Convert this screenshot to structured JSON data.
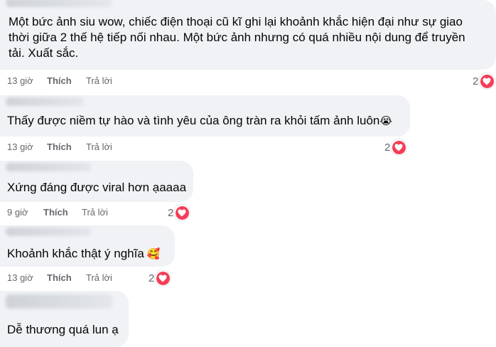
{
  "comments": [
    {
      "lines": [
        "Một bức ảnh siu wow, chiếc điện thoại cũ kĩ ghi lại khoảnh khắc hiện đại như sự giao",
        "thời giữa 2 thế hệ tiếp nối nhau. Một bức ảnh nhưng có quá nhiều nội dung để truyền",
        "tải. Xuất sắc."
      ],
      "emoji": "",
      "time": "13 giờ",
      "like": "Thích",
      "reply": "Trả lời",
      "reaction_count": "2",
      "reaction_icon": "heart-icon"
    },
    {
      "lines": [
        "Thấy được niềm tự hào và tình yêu của ông tràn ra khỏi tấm ảnh luôn"
      ],
      "emoji": "😭",
      "time": "13 giờ",
      "like": "Thích",
      "reply": "Trả lời",
      "reaction_count": "2",
      "reaction_icon": "heart-icon"
    },
    {
      "lines": [
        "Xứng đáng được viral hơn ạaaaa"
      ],
      "emoji": "",
      "time": "9 giờ",
      "like": "Thích",
      "reply": "Trả lời",
      "reaction_count": "2",
      "reaction_icon": "heart-icon"
    },
    {
      "lines": [
        "Khoảnh khắc thật ý nghĩa"
      ],
      "emoji": "🥰",
      "time": "13 giờ",
      "like": "Thích",
      "reply": "Trả lời",
      "reaction_count": "2",
      "reaction_icon": "heart-icon"
    },
    {
      "lines": [
        "Dễ thương quá lun ạ"
      ],
      "emoji": "",
      "time": "",
      "like": "",
      "reply": "",
      "reaction_count": "",
      "reaction_icon": ""
    }
  ],
  "colors": {
    "bubble": "#f0f2f5",
    "meta_text": "#65676b",
    "heart": "#f33e58"
  }
}
